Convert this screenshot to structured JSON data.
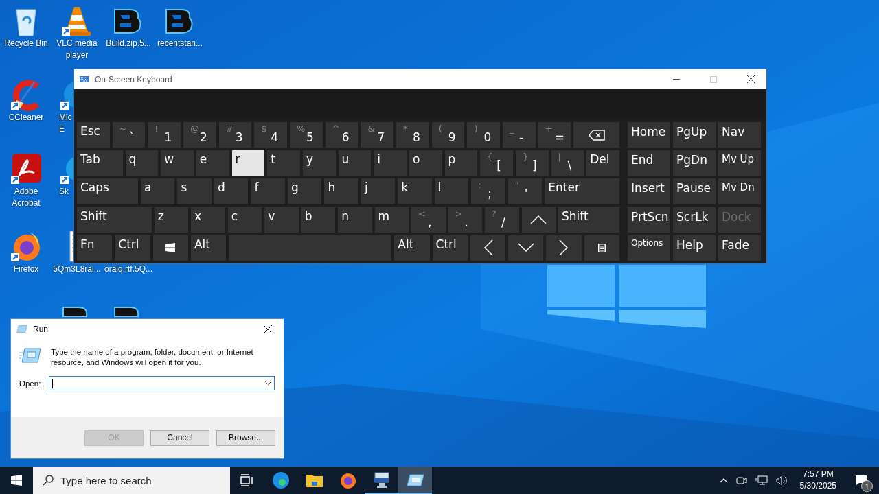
{
  "desktop_icons": [
    {
      "kind": "recycle",
      "lines": [
        "Recycle Bin"
      ]
    },
    {
      "kind": "vlc",
      "lines": [
        "VLC media",
        "player"
      ]
    },
    {
      "kind": "logo",
      "lines": [
        "Build.zip.5..."
      ]
    },
    {
      "kind": "logo",
      "lines": [
        "recentstan..."
      ]
    },
    {
      "kind": "ccleaner",
      "lines": [
        "CCleaner"
      ]
    },
    {
      "kind": "edge",
      "lines": [
        "Mic",
        "E"
      ]
    },
    {
      "kind": "acrobat",
      "lines": [
        "Adobe",
        "Acrobat"
      ]
    },
    {
      "kind": "skype",
      "lines": [
        "Sk"
      ]
    },
    {
      "kind": "firefox",
      "lines": [
        "Firefox"
      ]
    },
    {
      "kind": "document",
      "lines": [
        "5Qm3L8ral..."
      ]
    },
    {
      "kind": "covered",
      "lines": [
        "oralq.rtf.5Q..."
      ]
    },
    {
      "kind": "logo-top"
    },
    {
      "kind": "logo-top"
    }
  ],
  "osk": {
    "title": "On-Screen Keyboard",
    "keys": [
      [
        {
          "kind": "label",
          "text": "Esc",
          "highlighted": false
        },
        {
          "kind": "pair",
          "top": "~",
          "main": "`",
          "highlighted": false
        },
        {
          "kind": "pair",
          "top": "!",
          "main": "1",
          "highlighted": false
        },
        {
          "kind": "pair",
          "top": "@",
          "main": "2",
          "highlighted": false
        },
        {
          "kind": "pair",
          "top": "#",
          "main": "3",
          "highlighted": false
        },
        {
          "kind": "pair",
          "top": "$",
          "main": "4",
          "highlighted": false
        },
        {
          "kind": "pair",
          "top": "%",
          "main": "5",
          "highlighted": false
        },
        {
          "kind": "pair",
          "top": "^",
          "main": "6",
          "highlighted": false
        },
        {
          "kind": "pair",
          "top": "&",
          "main": "7",
          "highlighted": false
        },
        {
          "kind": "pair",
          "top": "*",
          "main": "8",
          "highlighted": false
        },
        {
          "kind": "pair",
          "top": "(",
          "main": "9",
          "highlighted": false
        },
        {
          "kind": "pair",
          "top": ")",
          "main": "0",
          "highlighted": false
        },
        {
          "kind": "pair",
          "top": "_",
          "main": "-",
          "highlighted": false
        },
        {
          "kind": "pair",
          "top": "+",
          "main": "=",
          "highlighted": false
        },
        {
          "kind": "backspace",
          "highlighted": false
        }
      ],
      [
        {
          "kind": "label",
          "text": "Tab",
          "highlighted": false
        },
        {
          "kind": "label",
          "text": "q",
          "highlighted": false
        },
        {
          "kind": "label",
          "text": "w",
          "highlighted": false
        },
        {
          "kind": "label",
          "text": "e",
          "highlighted": false
        },
        {
          "kind": "label",
          "text": "r",
          "highlighted": true
        },
        {
          "kind": "label",
          "text": "t",
          "highlighted": false
        },
        {
          "kind": "label",
          "text": "y",
          "highlighted": false
        },
        {
          "kind": "label",
          "text": "u",
          "highlighted": false
        },
        {
          "kind": "label",
          "text": "i",
          "highlighted": false
        },
        {
          "kind": "label",
          "text": "o",
          "highlighted": false
        },
        {
          "kind": "label",
          "text": "p",
          "highlighted": false
        },
        {
          "kind": "pair",
          "top": "{",
          "main": "[",
          "highlighted": false
        },
        {
          "kind": "pair",
          "top": "}",
          "main": "]",
          "highlighted": false
        },
        {
          "kind": "pair",
          "top": "|",
          "main": "\\",
          "highlighted": false
        },
        {
          "kind": "label",
          "text": "Del",
          "highlighted": false
        }
      ],
      [
        {
          "kind": "label",
          "text": "Caps",
          "highlighted": false
        },
        {
          "kind": "label",
          "text": "a",
          "highlighted": false
        },
        {
          "kind": "label",
          "text": "s",
          "highlighted": false
        },
        {
          "kind": "label",
          "text": "d",
          "highlighted": false
        },
        {
          "kind": "label",
          "text": "f",
          "highlighted": false
        },
        {
          "kind": "label",
          "text": "g",
          "highlighted": false
        },
        {
          "kind": "label",
          "text": "h",
          "highlighted": false
        },
        {
          "kind": "label",
          "text": "j",
          "highlighted": false
        },
        {
          "kind": "label",
          "text": "k",
          "highlighted": false
        },
        {
          "kind": "label",
          "text": "l",
          "highlighted": false
        },
        {
          "kind": "pair",
          "top": ":",
          "main": ";",
          "highlighted": false
        },
        {
          "kind": "pair",
          "top": "\"",
          "main": "'",
          "highlighted": false
        },
        {
          "kind": "label",
          "text": "Enter",
          "highlighted": false
        }
      ],
      [
        {
          "kind": "label",
          "text": "Shift",
          "highlighted": false
        },
        {
          "kind": "label",
          "text": "z",
          "highlighted": false
        },
        {
          "kind": "label",
          "text": "x",
          "highlighted": false
        },
        {
          "kind": "label",
          "text": "c",
          "highlighted": false
        },
        {
          "kind": "label",
          "text": "v",
          "highlighted": false
        },
        {
          "kind": "label",
          "text": "b",
          "highlighted": false
        },
        {
          "kind": "label",
          "text": "n",
          "highlighted": false
        },
        {
          "kind": "label",
          "text": "m",
          "highlighted": false
        },
        {
          "kind": "pair",
          "top": "<",
          "main": ",",
          "highlighted": false
        },
        {
          "kind": "pair",
          "top": ">",
          "main": ".",
          "highlighted": false
        },
        {
          "kind": "pair",
          "top": "?",
          "main": "/",
          "highlighted": false
        },
        {
          "kind": "up",
          "highlighted": false
        },
        {
          "kind": "label",
          "text": "Shift",
          "highlighted": false
        }
      ],
      [
        {
          "kind": "label",
          "text": "Fn",
          "highlighted": false
        },
        {
          "kind": "label",
          "text": "Ctrl",
          "highlighted": false
        },
        {
          "kind": "windows",
          "highlighted": false
        },
        {
          "kind": "label",
          "text": "Alt",
          "highlighted": false
        },
        {
          "kind": "space",
          "highlighted": false
        },
        {
          "kind": "label",
          "text": "Alt",
          "highlighted": false
        },
        {
          "kind": "label",
          "text": "Ctrl",
          "highlighted": false
        },
        {
          "kind": "left",
          "highlighted": false
        },
        {
          "kind": "down",
          "highlighted": false
        },
        {
          "kind": "right",
          "highlighted": false
        },
        {
          "kind": "menu",
          "highlighted": false
        }
      ]
    ],
    "nav_keys": [
      {
        "kind": "label",
        "text": "Home",
        "disabled": false
      },
      {
        "kind": "label",
        "text": "PgUp",
        "disabled": false
      },
      {
        "kind": "label",
        "text": "Nav",
        "disabled": false
      },
      {
        "kind": "label",
        "text": "End",
        "disabled": false
      },
      {
        "kind": "label",
        "text": "PgDn",
        "disabled": false
      },
      {
        "kind": "small",
        "text": "Mv Up",
        "disabled": false
      },
      {
        "kind": "label",
        "text": "Insert",
        "disabled": false
      },
      {
        "kind": "label",
        "text": "Pause",
        "disabled": false
      },
      {
        "kind": "small",
        "text": "Mv Dn",
        "disabled": false
      },
      {
        "kind": "label",
        "text": "PrtScn",
        "disabled": false
      },
      {
        "kind": "label",
        "text": "ScrLk",
        "disabled": false
      },
      {
        "kind": "label",
        "text": "Dock",
        "disabled": true
      },
      {
        "kind": "tiny",
        "text": "Options",
        "disabled": false
      },
      {
        "kind": "label",
        "text": "Help",
        "disabled": false
      },
      {
        "kind": "label",
        "text": "Fade",
        "disabled": false
      }
    ]
  },
  "run_dialog": {
    "title": "Run",
    "description": "Type the name of a program, folder, document, or Internet resource, and Windows will open it for you.",
    "open_label": "Open:",
    "buttons": [
      {
        "label": "OK",
        "disabled": true
      },
      {
        "label": "Cancel",
        "disabled": false
      },
      {
        "label": "Browse...",
        "disabled": false
      }
    ]
  },
  "taskbar": {
    "search": {
      "placeholder": "Type here to search"
    },
    "apps": [
      {
        "kind": "task-view",
        "running": false,
        "active": false
      },
      {
        "kind": "edge",
        "running": false,
        "active": false
      },
      {
        "kind": "explorer",
        "running": false,
        "active": false
      },
      {
        "kind": "firefox",
        "running": false,
        "active": false
      },
      {
        "kind": "osk",
        "running": true,
        "active": false
      },
      {
        "kind": "run",
        "running": true,
        "active": true
      }
    ],
    "time": "7:57 PM",
    "date": "5/30/2025",
    "notification_count": "1"
  }
}
